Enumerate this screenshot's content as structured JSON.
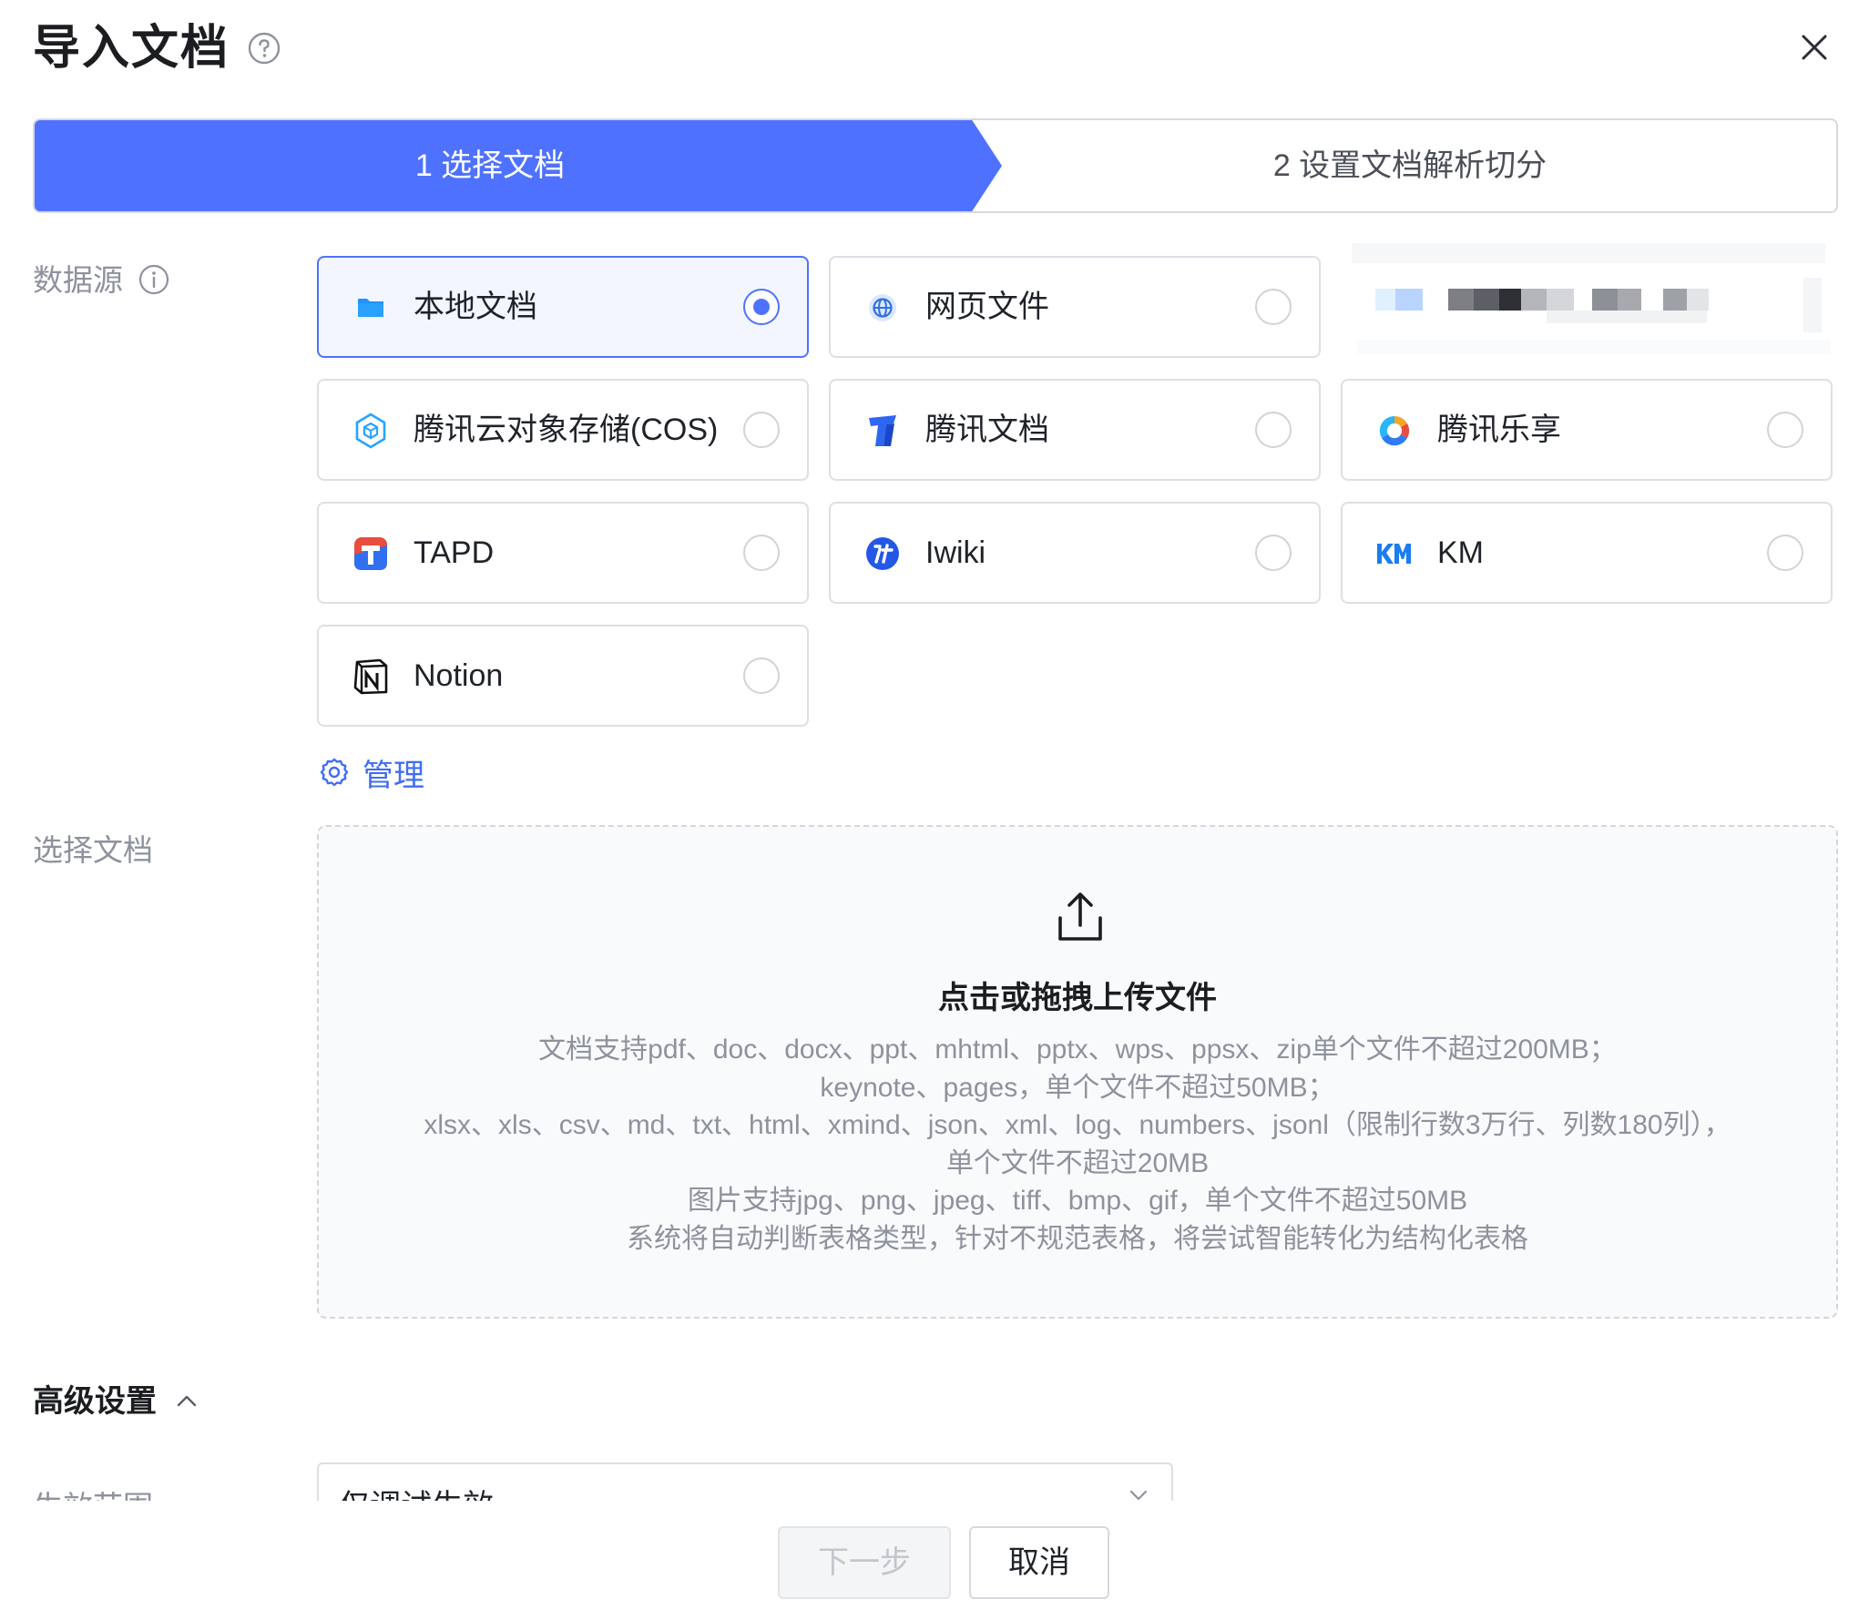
{
  "dialog": {
    "title": "导入文档"
  },
  "steps": [
    {
      "label": "1 选择文档",
      "active": true
    },
    {
      "label": "2 设置文档解析切分",
      "active": false
    }
  ],
  "form": {
    "source_label": "数据源",
    "select_doc_label": "选择文档",
    "manage_label": "管理"
  },
  "sources": [
    {
      "label": "本地文档",
      "icon": "folder-icon",
      "selected": true
    },
    {
      "label": "网页文件",
      "icon": "globe-icon",
      "selected": false
    },
    {
      "label": "腾讯云对象存储(COS)",
      "icon": "cos-icon",
      "selected": false
    },
    {
      "label": "腾讯文档",
      "icon": "tencent-docs-icon",
      "selected": false
    },
    {
      "label": "腾讯乐享",
      "icon": "lexiang-icon",
      "selected": false
    },
    {
      "label": "TAPD",
      "icon": "tapd-icon",
      "selected": false
    },
    {
      "label": "Iwiki",
      "icon": "iwiki-icon",
      "selected": false
    },
    {
      "label": "KM",
      "icon": "km-icon",
      "selected": false
    },
    {
      "label": "Notion",
      "icon": "notion-icon",
      "selected": false
    }
  ],
  "upload": {
    "title": "点击或拖拽上传文件",
    "lines": [
      "文档支持pdf、doc、docx、ppt、mhtml、pptx、wps、ppsx、zip单个文件不超过200MB；",
      "keynote、pages，单个文件不超过50MB；",
      "xlsx、xls、csv、md、txt、html、xmind、json、xml、log、numbers、jsonl（限制行数3万行、列数180列），",
      "单个文件不超过20MB",
      "图片支持jpg、png、jpeg、tiff、bmp、gif，单个文件不超过50MB",
      "系统将自动判断表格类型，针对不规范表格，将尝试智能转化为结构化表格"
    ]
  },
  "advanced": {
    "title": "高级设置",
    "scope_label": "生效范围",
    "scope_value": "仅调试生效"
  },
  "footer": {
    "next_label": "下一步",
    "cancel_label": "取消"
  },
  "colors": {
    "primary": "#4e72ff",
    "link": "#3f6df5",
    "muted_text": "#8d929c"
  }
}
